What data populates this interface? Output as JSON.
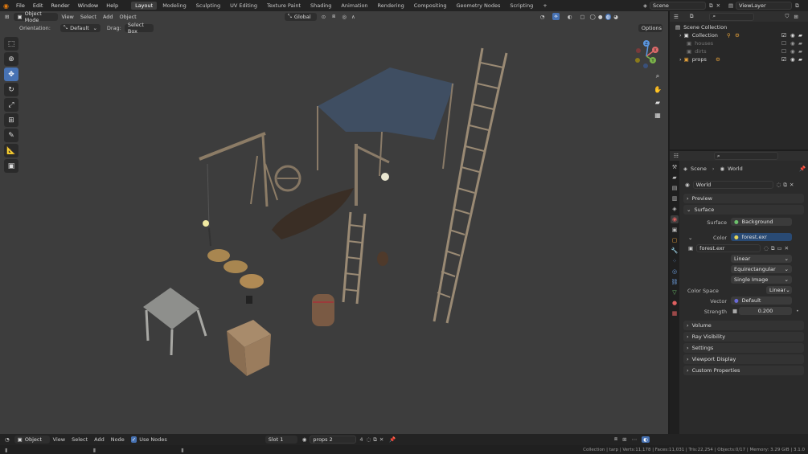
{
  "topbar": {
    "menus": [
      "File",
      "Edit",
      "Render",
      "Window",
      "Help"
    ],
    "workspaces": [
      "Layout",
      "Modeling",
      "Sculpting",
      "UV Editing",
      "Texture Paint",
      "Shading",
      "Animation",
      "Rendering",
      "Compositing",
      "Geometry Nodes",
      "Scripting"
    ],
    "active_workspace": "Layout",
    "add_tab": "+",
    "scene": "Scene",
    "view_layer": "ViewLayer"
  },
  "viewport_header": {
    "mode": "Object Mode",
    "menus": [
      "View",
      "Select",
      "Add",
      "Object"
    ],
    "transform": "Global",
    "orientation_label": "Orientation:",
    "orientation": "Default",
    "drag_label": "Drag:",
    "drag": "Select Box",
    "options": "Options"
  },
  "gizmo": {
    "x": "X",
    "y": "Y",
    "z": "Z"
  },
  "outliner": {
    "root": "Scene Collection",
    "items": [
      {
        "name": "Collection",
        "checked": true
      },
      {
        "name": "houses",
        "checked": false
      },
      {
        "name": "dirts",
        "checked": false
      },
      {
        "name": "props",
        "checked": true
      }
    ]
  },
  "properties": {
    "breadcrumb_scene": "Scene",
    "breadcrumb_world": "World",
    "world_name": "World",
    "panels": {
      "preview": "Preview",
      "surface": "Surface",
      "volume": "Volume",
      "ray_visibility": "Ray Visibility",
      "settings": "Settings",
      "viewport_display": "Viewport Display",
      "custom_properties": "Custom Properties"
    },
    "surface_label": "Surface",
    "surface_value": "Background",
    "color_label": "Color",
    "color_value": "forest.exr",
    "image_name": "forest.exr",
    "interpolation": "Linear",
    "projection": "Equirectangular",
    "extension": "Single Image",
    "color_space_label": "Color Space",
    "color_space": "Linear",
    "vector_label": "Vector",
    "vector_value": "Default",
    "strength_label": "Strength",
    "strength_value": "0.200"
  },
  "bottom_header": {
    "editor": "Object",
    "menus": [
      "View",
      "Select",
      "Add",
      "Node"
    ],
    "use_nodes_label": "Use Nodes",
    "use_nodes": true,
    "slot": "Slot 1",
    "material": "props 2"
  },
  "status": "Collection | tarp | Verts:11,178 | Faces:11,031 | Tris:22,254 | Objects:0/17 | Memory: 3.29 GiB | 3.1.0"
}
